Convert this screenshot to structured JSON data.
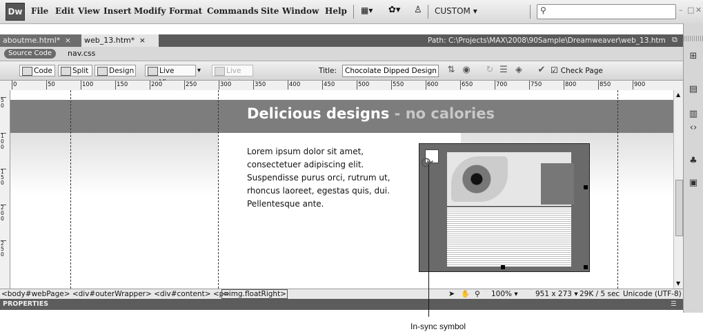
{
  "app": {
    "logo": "Dw"
  },
  "menu": [
    "File",
    "Edit",
    "View",
    "Insert",
    "Modify",
    "Format",
    "Commands",
    "Site",
    "Window",
    "Help"
  ],
  "workspace": "CUSTOM",
  "window_controls": {
    "minimize": "–",
    "restore": "□",
    "close": "✕"
  },
  "tabs": [
    {
      "label": "aboutme.html*",
      "close": "×"
    },
    {
      "label": "web_13.htm*",
      "close": "×"
    }
  ],
  "path": "Path: C:\\Projects\\MAX\\2008\\90Sample\\Dreamweaver\\web_13.htm",
  "related_files": {
    "source_code": "Source Code",
    "file": "nav.css"
  },
  "doc_toolbar": {
    "code": "Code",
    "split": "Split",
    "design": "Design",
    "live_view": "Live View",
    "live_code": "Live Code",
    "title_label": "Title:",
    "title_value": "Chocolate Dipped Design",
    "check_page": "Check Page"
  },
  "ruler_ticks": [
    "0",
    "50",
    "100",
    "150",
    "200",
    "250",
    "300",
    "350",
    "400",
    "450",
    "500",
    "550",
    "600",
    "650",
    "700",
    "750",
    "800",
    "850",
    "900"
  ],
  "vruler_ticks": [
    "5 0",
    "1 0 0",
    "1 5 0",
    "2 0 0",
    "2 5 0"
  ],
  "page": {
    "headline_main": "Delicious designs",
    "headline_sub": " - no calories",
    "body_text": "Lorem ipsum dolor sit amet, consectetuer adipiscing elit. Suspendisse purus orci, rutrum ut, rhoncus laoreet, egestas quis, dui. Pellentesque ante."
  },
  "status": {
    "tag_selector": "<body#webPage> <div#outerWrapper> <div#content> <p>",
    "selected_tag": "<img.floatRight>",
    "zoom": "100%",
    "dimensions": "951 x 273",
    "download": "29K / 5 sec",
    "encoding": "Unicode (UTF-8)"
  },
  "properties_label": "PROPERTIES",
  "annotation": "In-sync symbol"
}
